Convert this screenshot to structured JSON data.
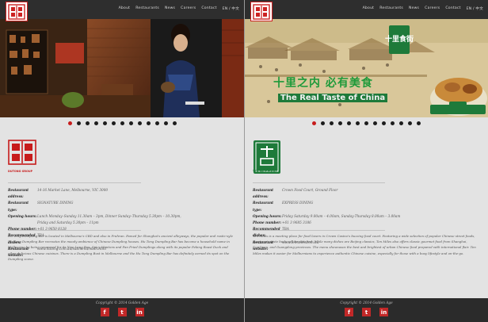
{
  "nav": {
    "links": [
      "About",
      "Restaurants",
      "News",
      "Careers",
      "Contact",
      "EN / 中文"
    ]
  },
  "slider": {
    "left_dot_count": 13,
    "left_active_dot": 0,
    "right_dot_count": 13,
    "right_active_dot": 0
  },
  "right_hero": {
    "chinese_tagline": "十里之内 必有美食",
    "english_tagline": "The Real Taste of China",
    "badge_text": "十里食街"
  },
  "left_restaurant": {
    "logo_caption": "DUTONG GROUP",
    "fields": [
      {
        "label": "Restaurant address:",
        "value": "14-16 Market Lane, Melbourne, VIC 3000"
      },
      {
        "label": "Restaurant type:",
        "value": "SIGNATURE DINING"
      },
      {
        "label": "Opening hours:",
        "value": "Lunch Monday–Sunday 11.30am – 3pm, Dinner Sunday–Thursday 5.30pm – 10.30pm,"
      },
      {
        "label": "",
        "value": "Friday and Saturday 5.30pm – 11pm"
      },
      {
        "label": "Phone number:",
        "value": "+61 3 9650 8128"
      },
      {
        "label": "Recommended dishes:",
        "value": "TBA"
      },
      {
        "label": "Restaurant website:",
        "value": "www.hutong.com.au/submenu/main.html"
      }
    ],
    "description": "Hu Tong Dumpling Bar is located in Melbourne's CBD and also in Prahran. Famed for Shanghai's ancient alleyways, the popular and rustic-syle Hu Tong Dumpling Bar recreates the moody ambience of Chinese Dumpling houses. Hu Tong Dumpling Bar has become a household name in Melbourne by being renowned for its Xiao Long Bao, Spicy Wontons and Pan Fried Dumplings along with its popular Peking Roast Duck and other delicious Chinese cuisines. There is a Dumpling Bust in Melbourne and the Hu Tong Dumpling Bar has definitely earned its spot on the Dumpling scene."
  },
  "right_restaurant": {
    "logo_caption": "TEN MILE FOOD",
    "fields": [
      {
        "label": "Restaurant address:",
        "value": "Crown Food Court, Ground Floor"
      },
      {
        "label": "Restaurant type:",
        "value": "EXPRESS DINING"
      },
      {
        "label": "Opening hours:",
        "value": "Friday Saturday 9.00am – 4.00am, Sunday-Thursday 8.00am – 3.00am"
      },
      {
        "label": "Phone number:",
        "value": "+61 3 9685 3186"
      },
      {
        "label": "Recommended dishes:",
        "value": "TBA"
      },
      {
        "label": "Restaurant website:",
        "value": "www.tenmiles.com.au"
      }
    ],
    "description": "Ten Miles is a meeting place for food lovers in Crown Casino's buzzing food court. Featuring a wide selection of popular Chinese street foods, everyone's taste buds will be satisfied. While many dishes are Beijing classics, Ten Miles also offers classic gourmet food from Shanghai, Szechuan, and Guangdong provinces. The menu showcases the best and brightest of urban Chinese food prepared with international flair. Ten Miles makes it easier for Melburnians to experience authentic Chinese cuisine, especially for those with a busy lifestyle and on-the-go."
  },
  "footer": {
    "copyright": "Copyright © 2014 Golden Age",
    "socials": [
      "facebook-icon",
      "twitter-icon",
      "linkedin-icon"
    ]
  },
  "colors": {
    "accent_red": "#c71c1c",
    "nav_bg": "#2e2e2e",
    "badge_green": "#1e7a3a"
  }
}
